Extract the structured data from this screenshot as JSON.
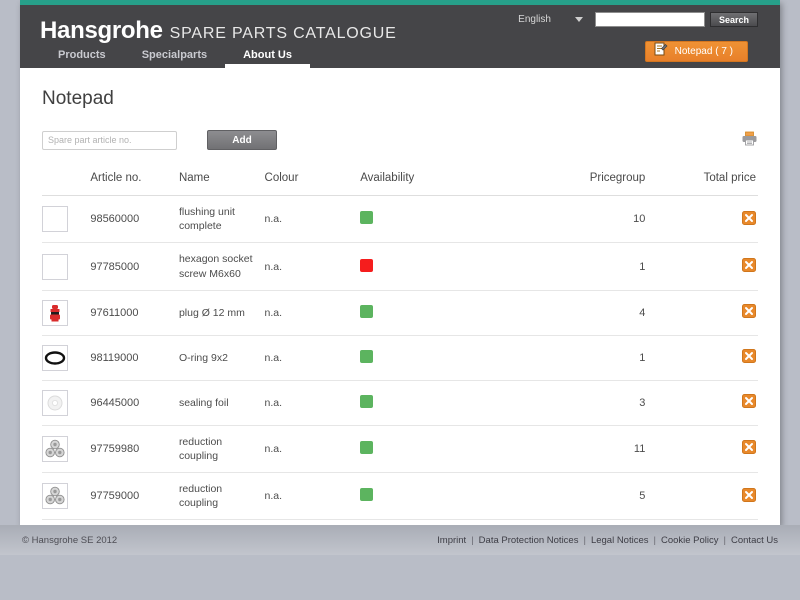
{
  "header": {
    "brand_name": "Hansgrohe",
    "brand_subtitle": "SPARE PARTS CATALOGUE",
    "language": "English",
    "search_value": "",
    "search_placeholder": "",
    "search_button": "Search",
    "notepad_button": "Notepad ( 7 )",
    "accent_color": "#e8802a",
    "strip_color": "#27a08a",
    "bar_color": "#454548"
  },
  "nav": {
    "items": [
      {
        "label": "Products",
        "active": false
      },
      {
        "label": "Specialparts",
        "active": false
      },
      {
        "label": "About Us",
        "active": true
      }
    ]
  },
  "main": {
    "title": "Notepad",
    "add_input_value": "",
    "add_input_placeholder": "Spare part article no.",
    "add_button": "Add",
    "print_icon": "printer-icon"
  },
  "table": {
    "columns": [
      "",
      "Article no.",
      "Name",
      "Colour",
      "Availability",
      "Pricegroup",
      "Total price"
    ],
    "rows": [
      {
        "thumb": "empty-box",
        "article_no": "98560000",
        "name": "flushing unit complete",
        "colour": "n.a.",
        "availability": "green",
        "pricegroup": "10",
        "total_price": "",
        "action": "delete-icon"
      },
      {
        "thumb": "empty-box",
        "article_no": "97785000",
        "name": "hexagon socket screw M6x60",
        "colour": "n.a.",
        "availability": "red",
        "pricegroup": "1",
        "total_price": "",
        "action": "delete-icon"
      },
      {
        "thumb": "plug-thumb",
        "article_no": "97611000",
        "name": "plug Ø 12 mm",
        "colour": "n.a.",
        "availability": "green",
        "pricegroup": "4",
        "total_price": "",
        "action": "delete-icon"
      },
      {
        "thumb": "oring-thumb",
        "article_no": "98119000",
        "name": "O-ring 9x2",
        "colour": "n.a.",
        "availability": "green",
        "pricegroup": "1",
        "total_price": "",
        "action": "delete-icon"
      },
      {
        "thumb": "foil-thumb",
        "article_no": "96445000",
        "name": "sealing foil",
        "colour": "n.a.",
        "availability": "green",
        "pricegroup": "3",
        "total_price": "",
        "action": "delete-icon"
      },
      {
        "thumb": "coupling-thumb",
        "article_no": "97759980",
        "name": "reduction coupling",
        "colour": "n.a.",
        "availability": "green",
        "pricegroup": "11",
        "total_price": "",
        "action": "delete-icon"
      },
      {
        "thumb": "coupling-thumb",
        "article_no": "97759000",
        "name": "reduction coupling",
        "colour": "n.a.",
        "availability": "green",
        "pricegroup": "5",
        "total_price": "",
        "action": "delete-icon"
      }
    ],
    "availability_colors": {
      "green": "#5cb45f",
      "red": "#f51d1d"
    }
  },
  "footer": {
    "copyright": "© Hansgrohe SE 2012",
    "links": [
      "Imprint",
      "Data Protection Notices",
      "Legal Notices",
      "Cookie Policy",
      "Contact Us"
    ],
    "separator": "|"
  }
}
